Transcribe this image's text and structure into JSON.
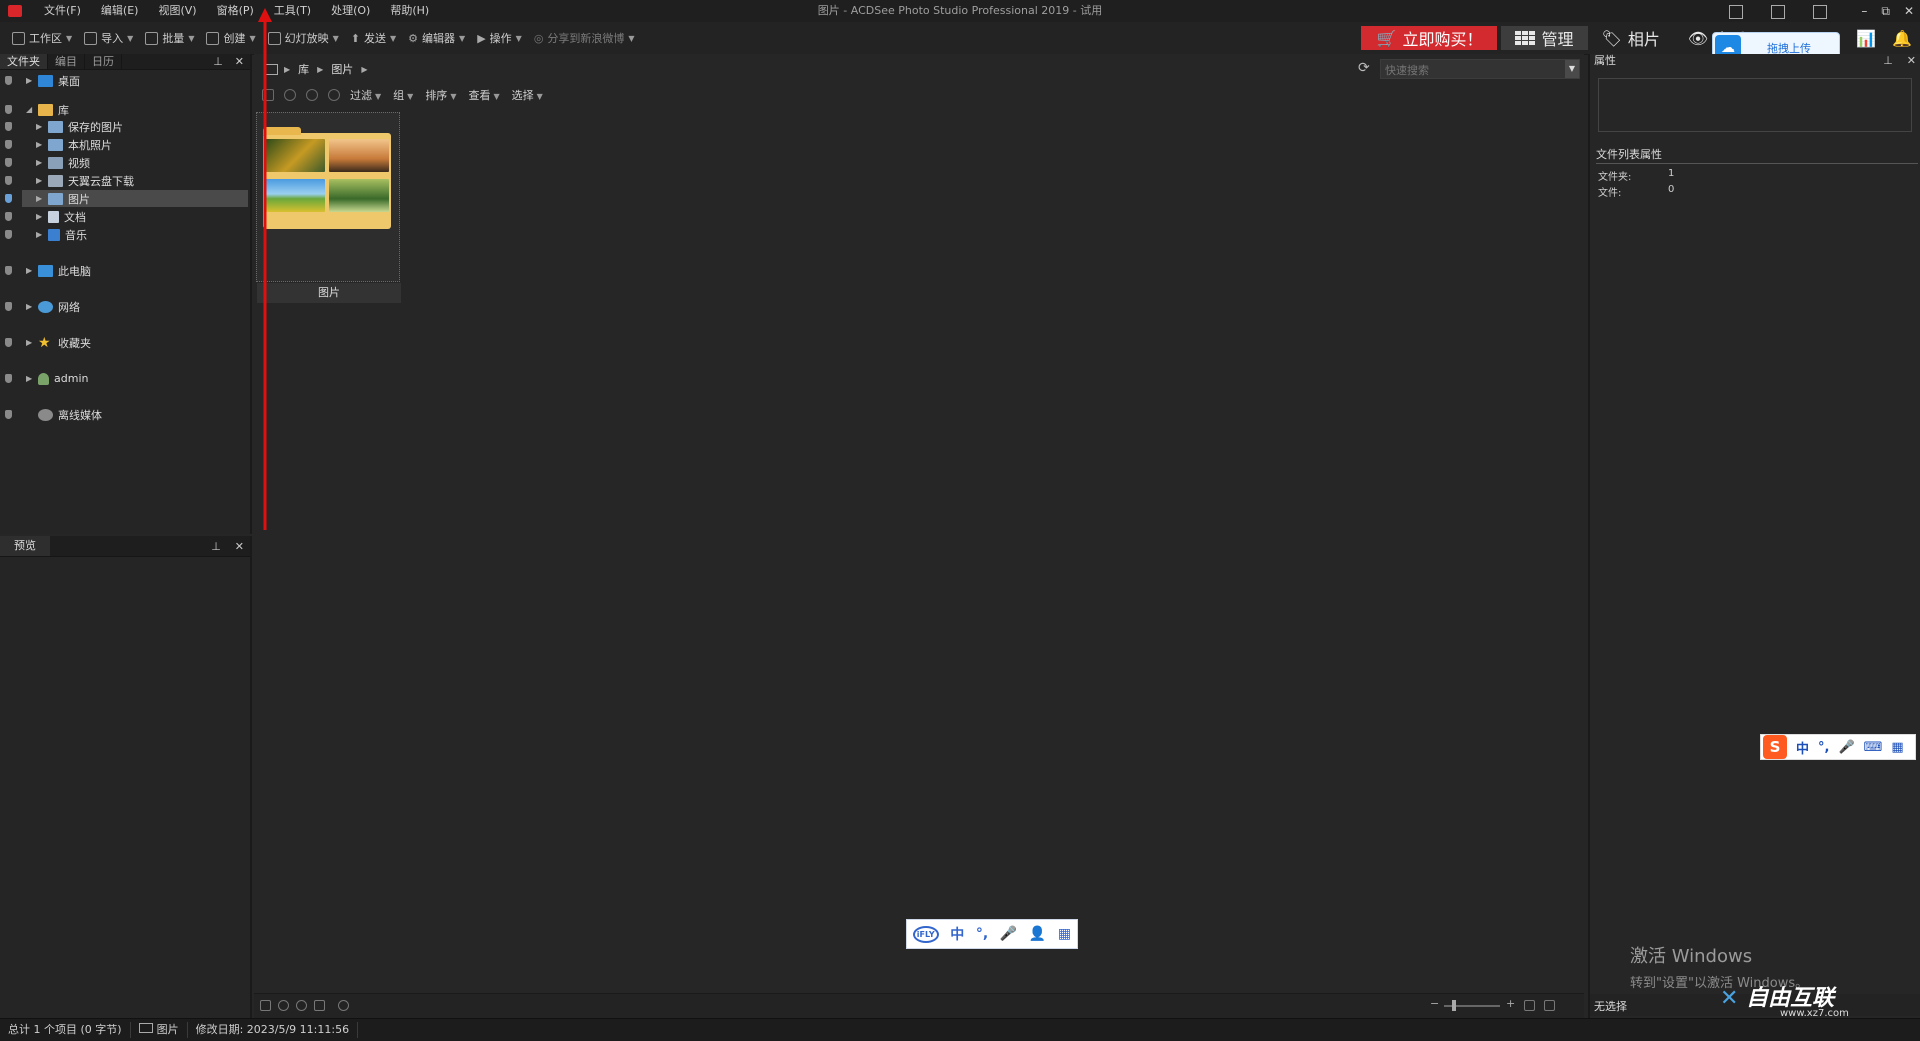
{
  "window": {
    "title": "图片 - ACDSee Photo Studio Professional 2019 - 试用",
    "controls": [
      "–",
      "⧉",
      "✕"
    ]
  },
  "menu": [
    "文件(F)",
    "编辑(E)",
    "视图(V)",
    "窗格(P)",
    "工具(T)",
    "处理(O)",
    "帮助(H)"
  ],
  "toolbar": {
    "items": [
      "工作区",
      "导入",
      "批量",
      "创建",
      "幻灯放映",
      "发送",
      "编辑器",
      "操作",
      "分享到新浪微博"
    ],
    "buy_label": "立即购买！",
    "modes": [
      "管理",
      "相片",
      "查看"
    ]
  },
  "upload_popup": {
    "label": "拖拽上传"
  },
  "left_panel": {
    "tabs": [
      "文件夹",
      "编目",
      "日历"
    ],
    "tree": {
      "desktop": "桌面",
      "library": "库",
      "saved_pictures": "保存的图片",
      "camera_roll": "本机照片",
      "videos": "视频",
      "cloud_downloads": "天翼云盘下载",
      "pictures": "图片",
      "documents": "文档",
      "music": "音乐",
      "this_pc": "此电脑",
      "network": "网络",
      "favorites": "收藏夹",
      "admin": "admin",
      "offline_media": "离线媒体"
    }
  },
  "preview_panel": {
    "title": "预览"
  },
  "center": {
    "breadcrumb": [
      "库",
      "图片"
    ],
    "search_placeholder": "快速搜索",
    "filters": [
      "过滤",
      "组",
      "排序",
      "查看",
      "选择"
    ],
    "thumbnail": {
      "caption": "图片"
    }
  },
  "ime_bar": {
    "items": [
      "iFLY",
      "中",
      "°,",
      "🎤",
      "👤",
      "▦"
    ]
  },
  "right_panel": {
    "title": "属性",
    "section_title": "文件列表属性",
    "rows": [
      {
        "label": "文件夹:",
        "value": "1"
      },
      {
        "label": "文件:",
        "value": "0"
      }
    ],
    "footer_label": "无选择"
  },
  "sogou_bar": {
    "items": [
      "中",
      "°,",
      "🎤",
      "⌨",
      "▦"
    ]
  },
  "activation": {
    "line1": "激活 Windows",
    "line2": "转到\"设置\"以激活 Windows。"
  },
  "watermark": {
    "brand": "自由互联",
    "site": "www.xz7.com"
  },
  "status": {
    "total": "总计 1 个项目 (0 字节)",
    "location": "图片",
    "modified": "修改日期: 2023/5/9 11:11:56"
  },
  "colors": {
    "accent_red": "#d32a2f",
    "background": "#262626",
    "selection": "#4a4a4a"
  }
}
